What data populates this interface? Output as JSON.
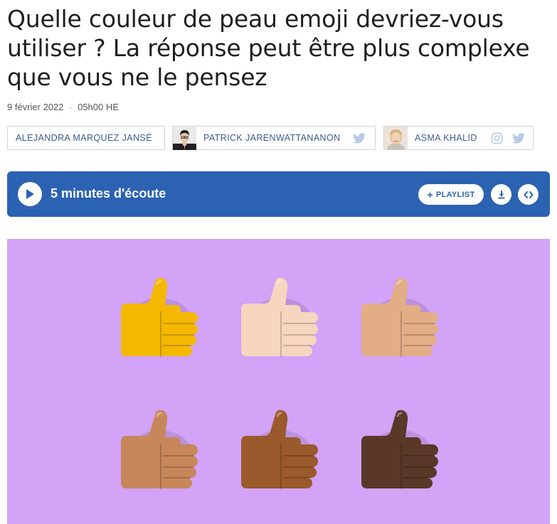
{
  "article": {
    "title": "Quelle couleur de peau emoji devriez-vous utiliser ? La réponse peut être plus complexe que vous ne le pensez",
    "date": "9 février 2022",
    "separator": "·",
    "time": "05h00 HE"
  },
  "bylines": [
    {
      "name": "ALEJANDRA MARQUEZ JANSÉ"
    },
    {
      "name": "PATRICK JARENWATTANANON",
      "icons": [
        "twitter-icon"
      ]
    },
    {
      "name": "ASMA KHALID",
      "icons": [
        "instagram-icon",
        "twitter-icon"
      ]
    }
  ],
  "player": {
    "listen_label": "5 minutes d'écoute",
    "playlist_plus": "+",
    "playlist_label": "PLAYLIST",
    "icons": [
      "play-icon",
      "download-icon",
      "embed-icon"
    ]
  },
  "hero": {
    "background_color": "#d2a3f7",
    "emoji": "thumbs-up",
    "skin_tones": [
      "#f5b800",
      "#f6d6be",
      "#e3ad86",
      "#c8875a",
      "#9a5a2b",
      "#5a3828"
    ]
  }
}
